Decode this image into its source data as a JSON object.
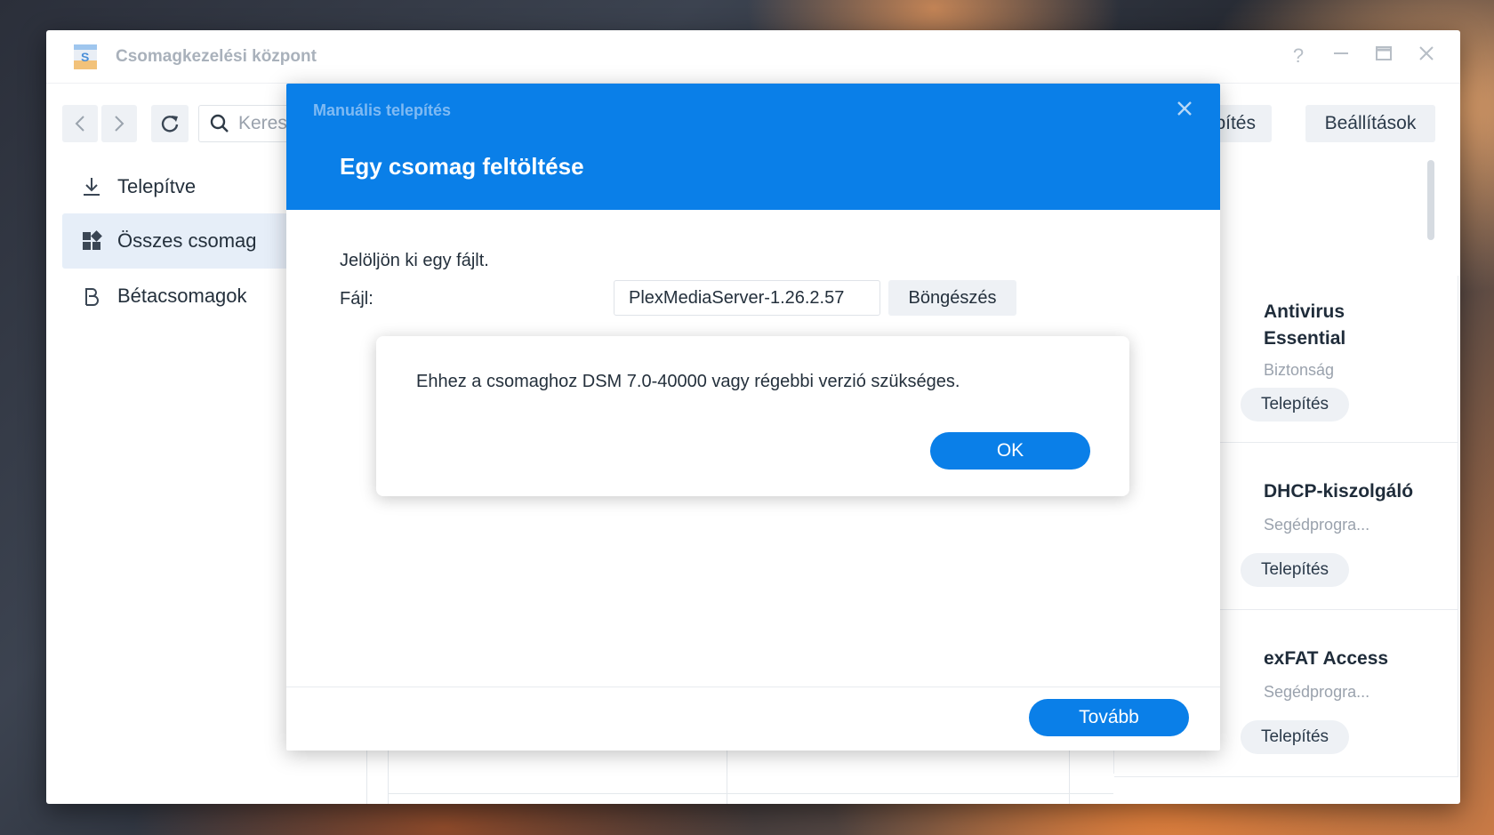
{
  "window": {
    "title": "Csomagkezelési központ",
    "controls": [
      "help-icon",
      "minimize-icon",
      "maximize-icon",
      "close-icon"
    ]
  },
  "toolbar": {
    "search_placeholder": "Keres",
    "manual_install_label": "elepítés",
    "settings_label": "Beállítások"
  },
  "sidebar": {
    "items": [
      {
        "label": "Telepítve",
        "icon": "download-icon"
      },
      {
        "label": "Összes csomag",
        "icon": "grid-icon",
        "active": true
      },
      {
        "label": "Bétacsomagok",
        "icon": "beta-icon"
      }
    ]
  },
  "packages": [
    {
      "name": "Antivirus\nEssential",
      "category": "Biztonság",
      "install_label": "Telepítés"
    },
    {
      "name": "DHCP-kiszolgáló",
      "category": "Segédprogra...",
      "install_label": "Telepítés"
    },
    {
      "name": "exFAT Access",
      "category": "Segédprogra...",
      "install_label": "Telepítés"
    }
  ],
  "modal": {
    "subtitle": "Manuális telepítés",
    "title": "Egy csomag feltöltése",
    "prompt": "Jelöljön ki egy fájlt.",
    "file_label": "Fájl:",
    "file_value": "PlexMediaServer-1.26.2.57",
    "browse_label": "Böngészés",
    "next_label": "Tovább"
  },
  "alert": {
    "message": "Ehhez a csomaghoz DSM 7.0-40000 vagy régebbi verzió szükséges.",
    "ok_label": "OK"
  },
  "colors": {
    "accent": "#0a7fe8",
    "sidebar_active": "#e6eef8"
  }
}
